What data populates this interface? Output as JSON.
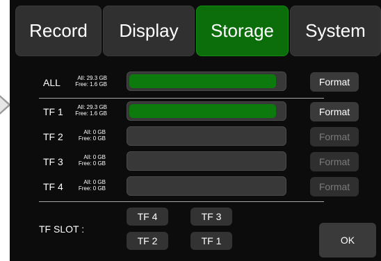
{
  "tabs": [
    {
      "label": "Record",
      "active": false
    },
    {
      "label": "Display",
      "active": false
    },
    {
      "label": "Storage",
      "active": true
    },
    {
      "label": "System",
      "active": false
    }
  ],
  "storage": {
    "rows": [
      {
        "name": "ALL",
        "all": "All: 29.3 GB",
        "free": "Free: 1.6 GB",
        "used_fraction": 0.95,
        "format_label": "Format",
        "format_enabled": true
      },
      {
        "name": "TF 1",
        "all": "All: 29.3 GB",
        "free": "Free: 1.6 GB",
        "used_fraction": 0.95,
        "format_label": "Format",
        "format_enabled": true
      },
      {
        "name": "TF 2",
        "all": "All: 0 GB",
        "free": "Free: 0 GB",
        "used_fraction": 0,
        "format_label": "Format",
        "format_enabled": false
      },
      {
        "name": "TF 3",
        "all": "All: 0 GB",
        "free": "Free: 0 GB",
        "used_fraction": 0,
        "format_label": "Format",
        "format_enabled": false
      },
      {
        "name": "TF 4",
        "all": "All: 0 GB",
        "free": "Free: 0 GB",
        "used_fraction": 0,
        "format_label": "Format",
        "format_enabled": false
      }
    ]
  },
  "slot": {
    "label": "TF SLOT :",
    "buttons": [
      "TF 4",
      "TF 3",
      "TF 2",
      "TF 1"
    ]
  },
  "ok_label": "OK",
  "colors": {
    "accent": "#0b6e0b",
    "background": "#0c0c0c",
    "button": "#3a3a3a"
  }
}
